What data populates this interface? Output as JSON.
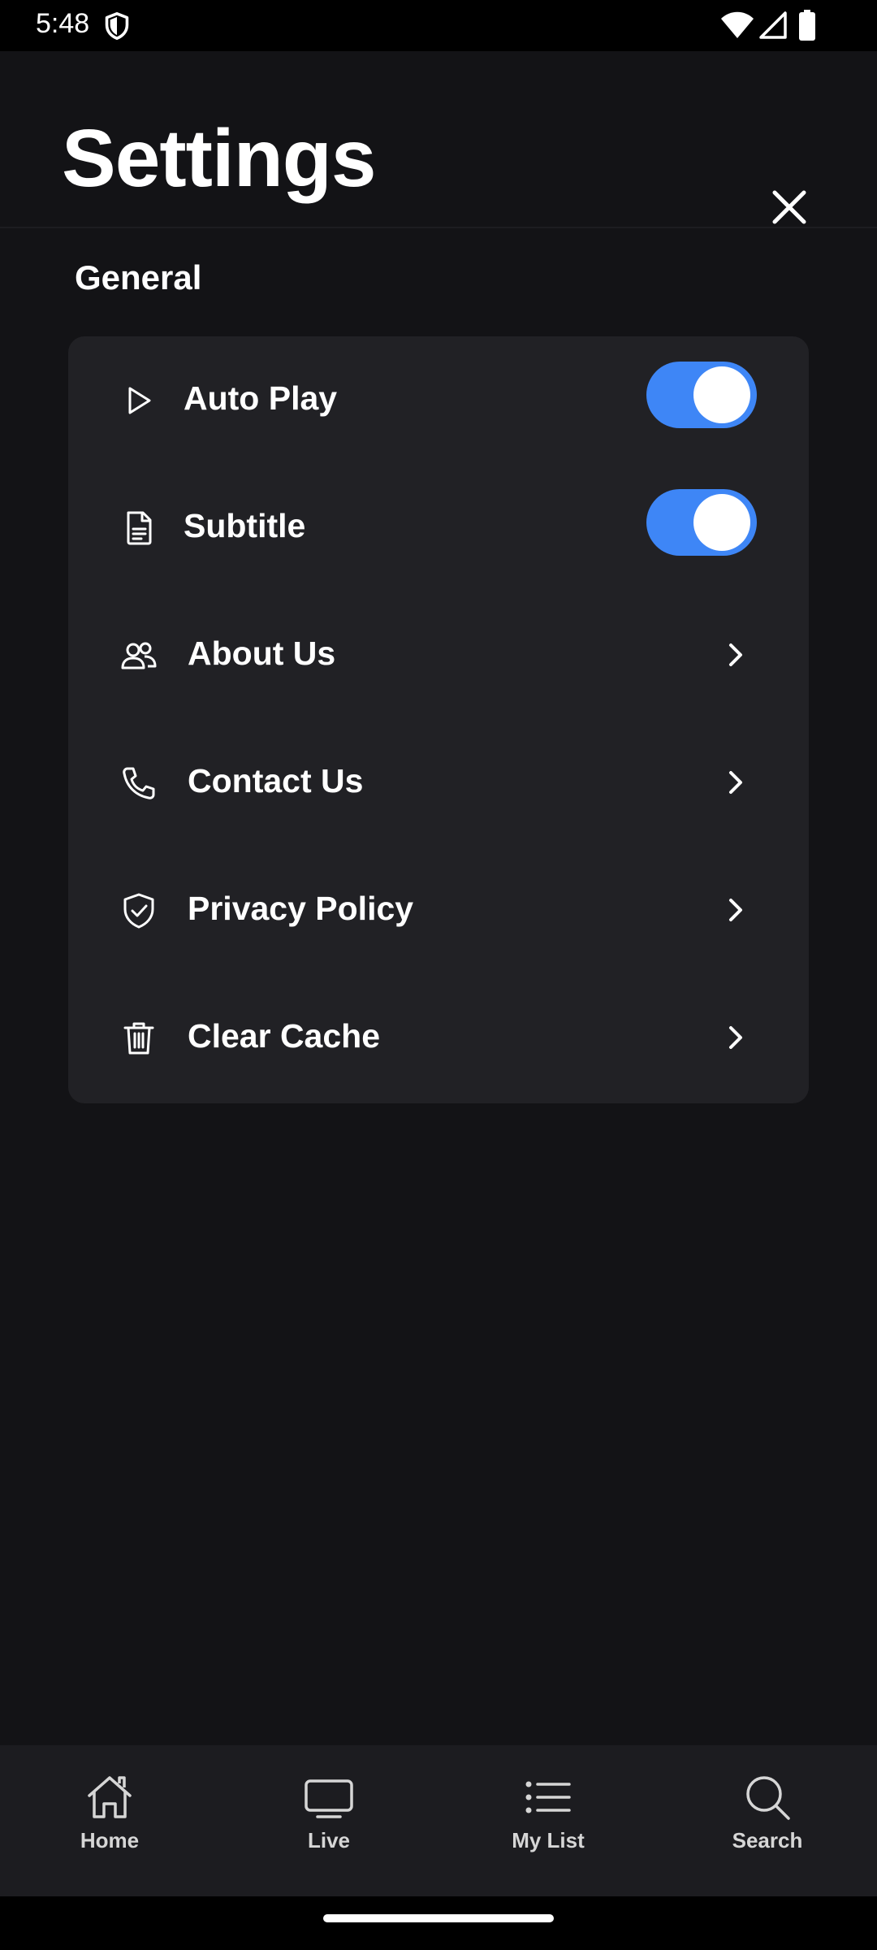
{
  "status_bar": {
    "time": "5:48"
  },
  "header": {
    "title": "Settings"
  },
  "general": {
    "section_title": "General",
    "items": [
      {
        "label": "Auto Play",
        "icon": "play-icon",
        "control": "toggle",
        "enabled": true
      },
      {
        "label": "Subtitle",
        "icon": "document-icon",
        "control": "toggle",
        "enabled": true
      },
      {
        "label": "About Us",
        "icon": "users-icon",
        "control": "chevron"
      },
      {
        "label": "Contact Us",
        "icon": "phone-icon",
        "control": "chevron"
      },
      {
        "label": "Privacy Policy",
        "icon": "shield-check-icon",
        "control": "chevron"
      },
      {
        "label": "Clear Cache",
        "icon": "trash-icon",
        "control": "chevron"
      }
    ]
  },
  "bottom_nav": {
    "items": [
      {
        "label": "Home",
        "icon": "home-icon"
      },
      {
        "label": "Live",
        "icon": "tv-icon"
      },
      {
        "label": "My List",
        "icon": "list-icon"
      },
      {
        "label": "Search",
        "icon": "search-icon"
      }
    ]
  },
  "colors": {
    "background": "#131316",
    "card": "#212125",
    "toggle_on": "#3e86f6",
    "text": "#ffffff"
  }
}
